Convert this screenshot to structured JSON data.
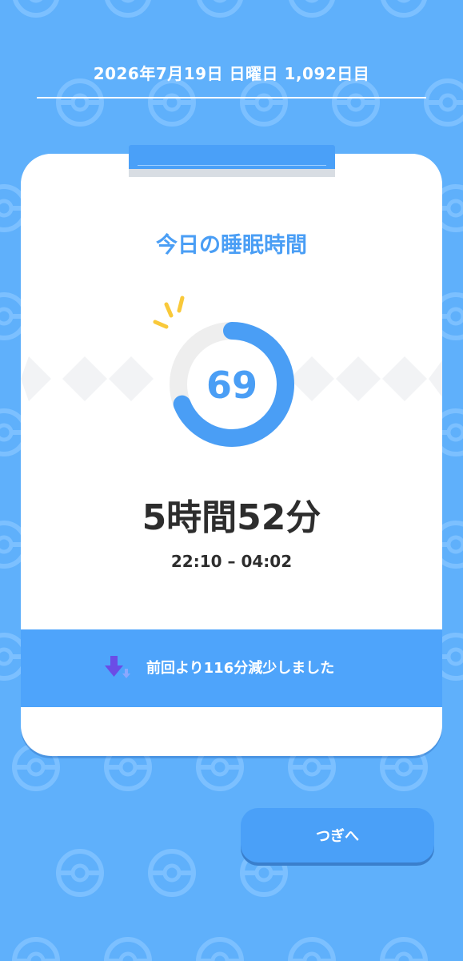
{
  "header": {
    "date_text": "2026年7月19日 日曜日 1,092日目"
  },
  "card": {
    "title": "今日の睡眠時間",
    "score": "69",
    "score_fraction": 0.69,
    "duration": "5時間52分",
    "time_range": "22:10 – 04:02",
    "comparison": "前回より116分減少しました"
  },
  "next_button": {
    "label": "つぎへ"
  },
  "colors": {
    "background": "#5fb0fb",
    "accent": "#4a9ef5",
    "text_dark": "#2d2d2d",
    "ring_track": "#eeeeee",
    "spark": "#f9c93a",
    "down_arrow": "#6b4ce6"
  }
}
